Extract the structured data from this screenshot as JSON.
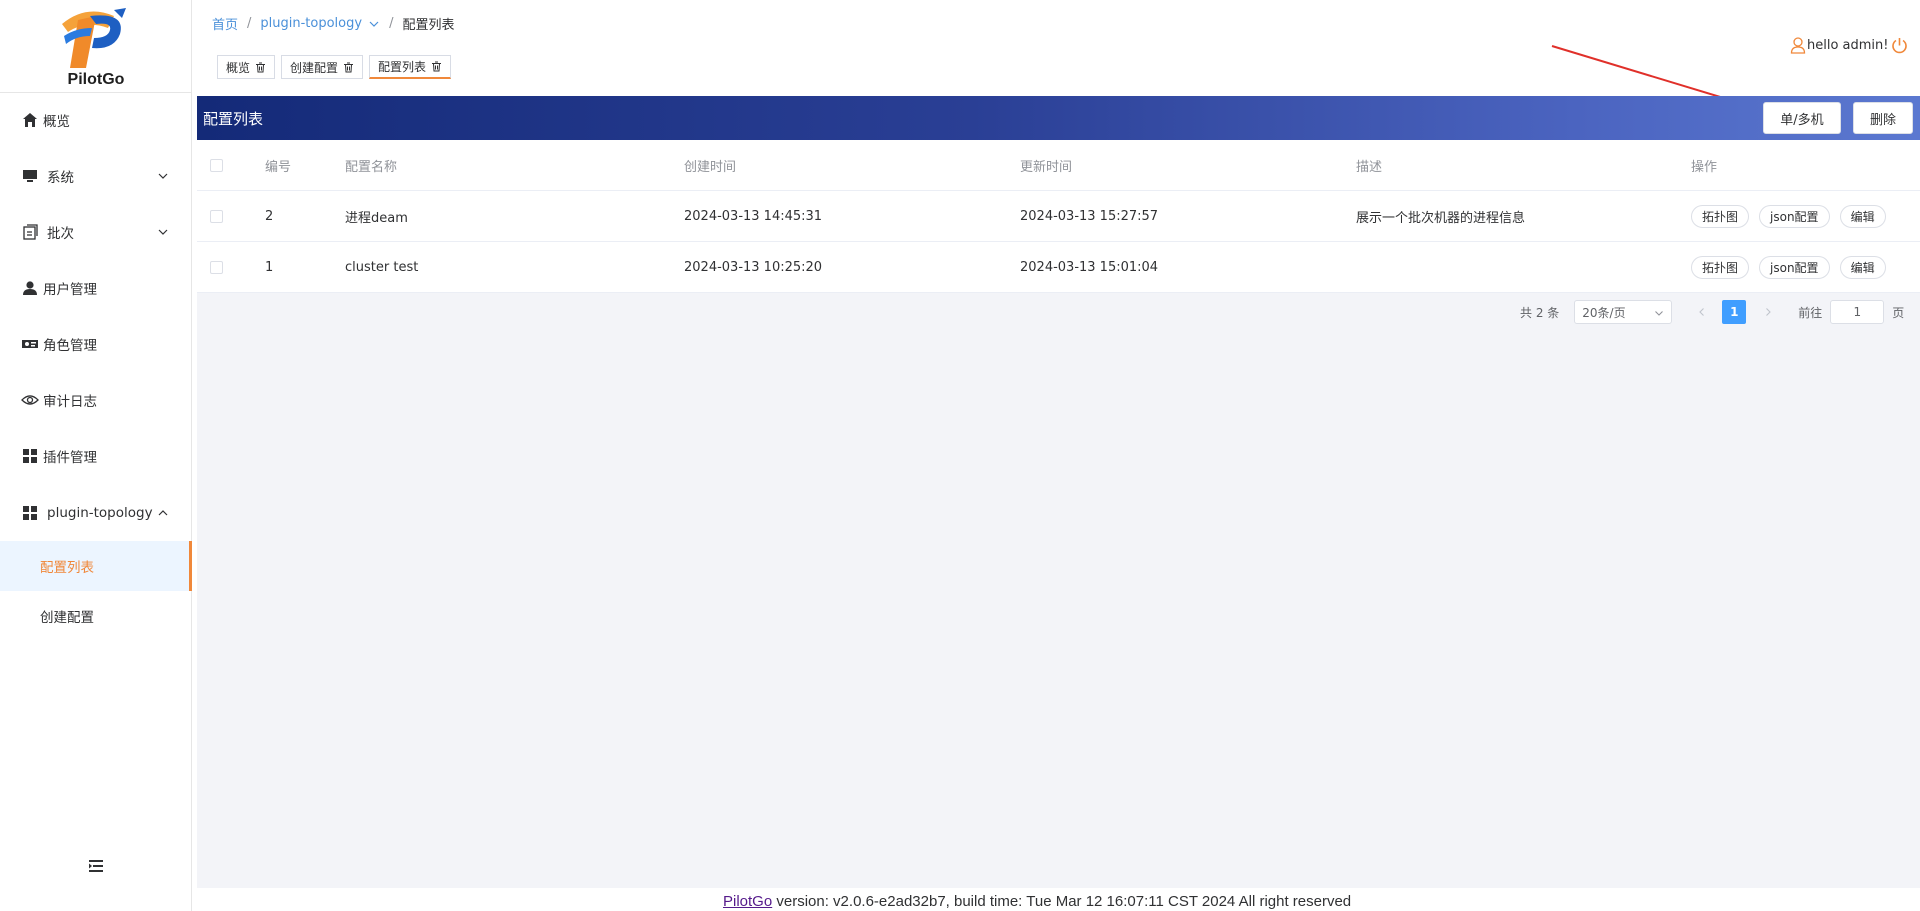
{
  "app": {
    "logo_text": "PilotGo"
  },
  "sidebar": {
    "items": [
      {
        "label": "概览",
        "icon": "home-icon"
      },
      {
        "label": "系统",
        "icon": "monitor-icon"
      },
      {
        "label": "批次",
        "icon": "batch-icon"
      },
      {
        "label": "用户管理",
        "icon": "user-icon"
      },
      {
        "label": "角色管理",
        "icon": "role-icon"
      },
      {
        "label": "审计日志",
        "icon": "eye-icon"
      },
      {
        "label": "插件管理",
        "icon": "grid-icon"
      },
      {
        "label": "plugin-topology",
        "icon": "grid-icon"
      }
    ],
    "sub_items": [
      {
        "label": "配置列表",
        "active": true
      },
      {
        "label": "创建配置",
        "active": false
      }
    ]
  },
  "header": {
    "breadcrumb": [
      "首页",
      "plugin-topology",
      "配置列表"
    ],
    "tabs": [
      {
        "label": "概览"
      },
      {
        "label": "创建配置"
      },
      {
        "label": "配置列表",
        "active": true
      }
    ],
    "user_text": "hello admin!"
  },
  "panel": {
    "title": "配置列表",
    "buttons": {
      "multi": "单/多机",
      "delete": "删除"
    }
  },
  "table": {
    "headers": [
      "编号",
      "配置名称",
      "创建时间",
      "更新时间",
      "描述",
      "操作"
    ],
    "rows": [
      {
        "id": "2",
        "name": "进程deam",
        "created": "2024-03-13 14:45:31",
        "updated": "2024-03-13 15:27:57",
        "desc": "展示一个批次机器的进程信息"
      },
      {
        "id": "1",
        "name": "cluster test",
        "created": "2024-03-13 10:25:20",
        "updated": "2024-03-13 15:01:04",
        "desc": ""
      }
    ],
    "ops": [
      "拓扑图",
      "json配置",
      "编辑"
    ]
  },
  "pagination": {
    "total": "共 2 条",
    "page_size": "20条/页",
    "current": "1",
    "goto_label": "前往",
    "goto_value": "1",
    "page_suffix": "页"
  },
  "footer": {
    "link": "PilotGo",
    "text": " version: v2.0.6-e2ad32b7, build time: Tue Mar 12 16:07:11 CST 2024 All right reserved"
  },
  "colors": {
    "accent": "#f0883a",
    "primary": "#409eff",
    "header_dark": "#142a78",
    "arrow": "#e0302a"
  }
}
